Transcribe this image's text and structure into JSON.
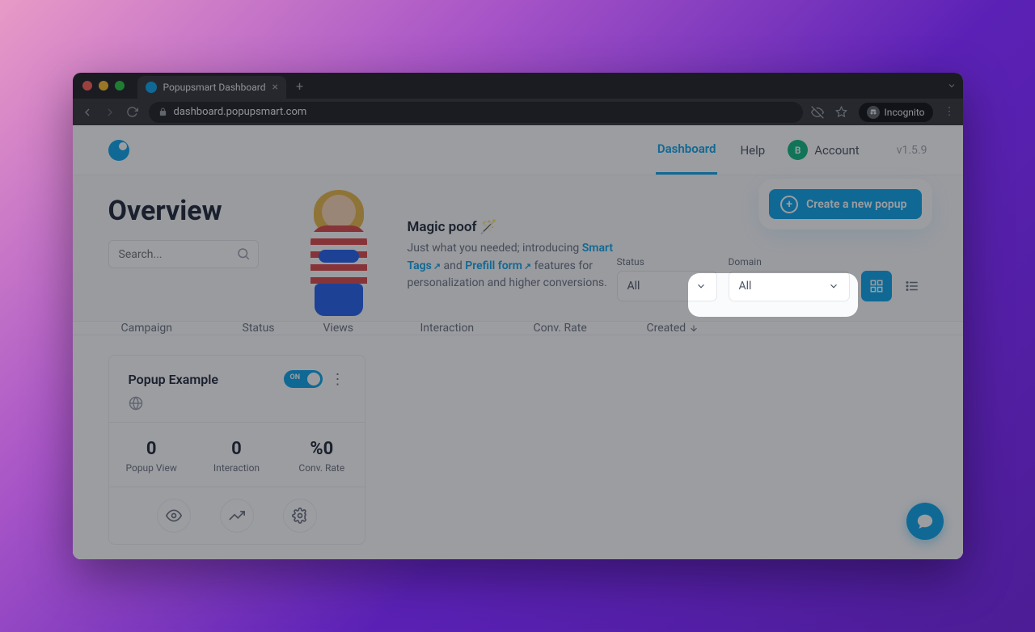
{
  "browser": {
    "tabTitle": "Popupsmart Dashboard",
    "url": "dashboard.popupsmart.com",
    "incognito": "Incognito"
  },
  "header": {
    "navDashboard": "Dashboard",
    "navHelp": "Help",
    "accountLabel": "Account",
    "avatarInitial": "B",
    "version": "v1.5.9"
  },
  "hero": {
    "title": "Overview",
    "searchPlaceholder": "Search...",
    "magicTitle": "Magic poof 🪄",
    "magicLead": "Just what you needed; introducing ",
    "smartTags": "Smart Tags",
    "andWord": " and ",
    "prefillForm": "Prefill form",
    "magicTail": " features for personalization and higher conversions."
  },
  "filters": {
    "statusLabel": "Status",
    "statusValue": "All",
    "domainLabel": "Domain",
    "domainValue": "All"
  },
  "create": {
    "label": "Create a new popup"
  },
  "table": {
    "campaign": "Campaign",
    "status": "Status",
    "views": "Views",
    "interaction": "Interaction",
    "convRate": "Conv. Rate",
    "created": "Created"
  },
  "card": {
    "title": "Popup Example",
    "toggle": "ON",
    "stats": [
      {
        "value": "0",
        "label": "Popup View"
      },
      {
        "value": "0",
        "label": "Interaction"
      },
      {
        "value": "%0",
        "label": "Conv. Rate"
      }
    ]
  }
}
